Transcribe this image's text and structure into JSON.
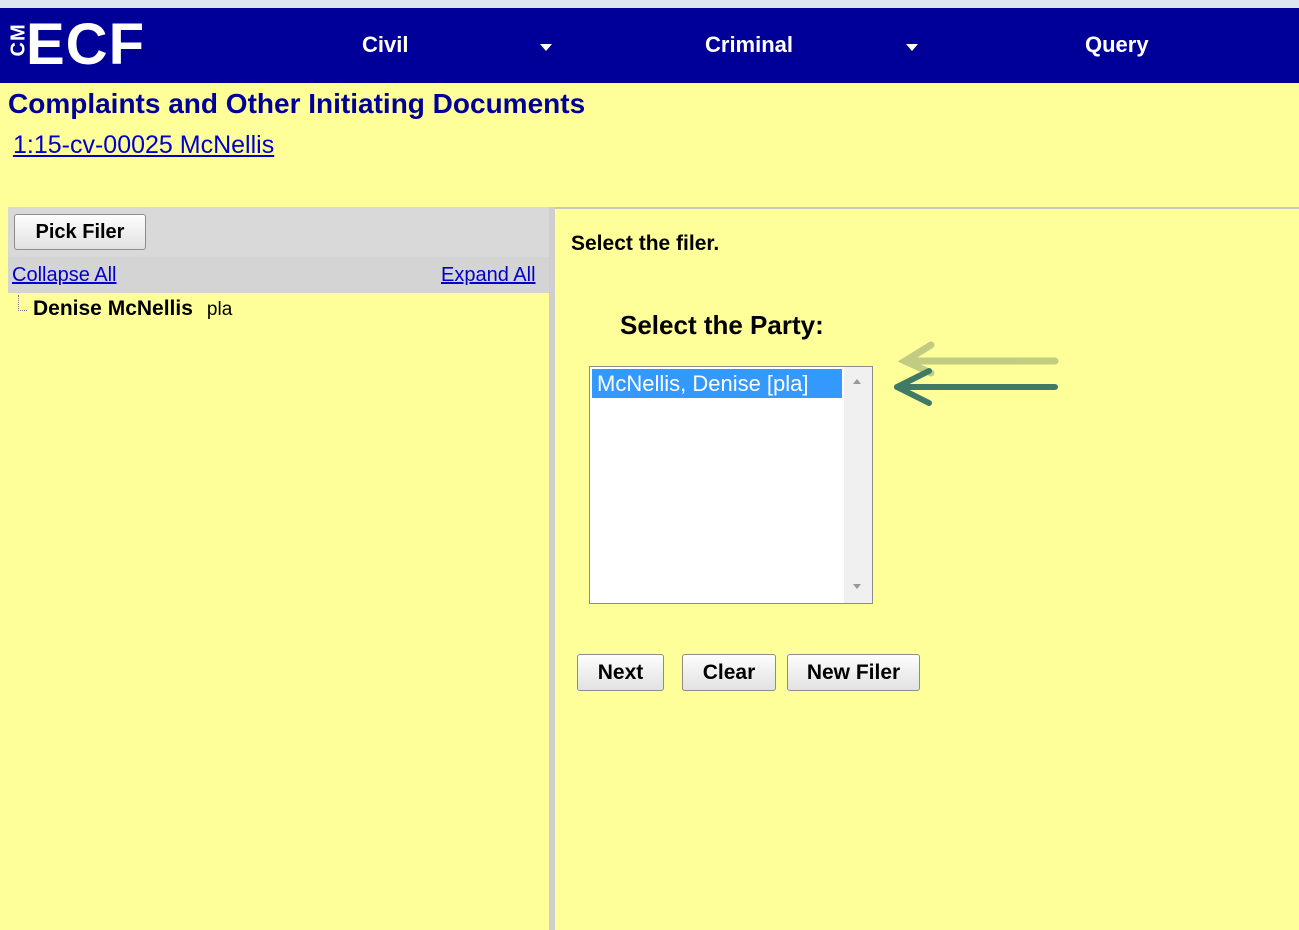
{
  "navbar": {
    "logo_small": "CM",
    "logo_main": "ECF",
    "items": [
      {
        "label": "Civil"
      },
      {
        "label": "Criminal"
      },
      {
        "label": "Query"
      }
    ]
  },
  "page": {
    "title": "Complaints and Other Initiating Documents",
    "case_link": "1:15-cv-00025 McNellis"
  },
  "left_pane": {
    "pick_filer_button": "Pick Filer",
    "collapse_all": "Collapse All",
    "expand_all": "Expand All",
    "tree": [
      {
        "name": "Denise McNellis",
        "role": "pla"
      }
    ]
  },
  "right_pane": {
    "instruction": "Select the filer.",
    "party_heading": "Select the Party:",
    "party_options": [
      {
        "label": "McNellis, Denise [pla]",
        "selected": true
      }
    ],
    "buttons": {
      "next": "Next",
      "clear": "Clear",
      "new_filer": "New Filer"
    }
  },
  "colors": {
    "navbar_bg": "#000099",
    "page_bg": "#ffff99",
    "title_color": "#000099",
    "selection_bg": "#3399ff",
    "annotation_arrow": "#3f7a66"
  },
  "icons": [
    "caret-down-icon",
    "tree-connector-icon",
    "scroll-up-icon",
    "scroll-down-icon",
    "annotation-arrow-icon"
  ]
}
